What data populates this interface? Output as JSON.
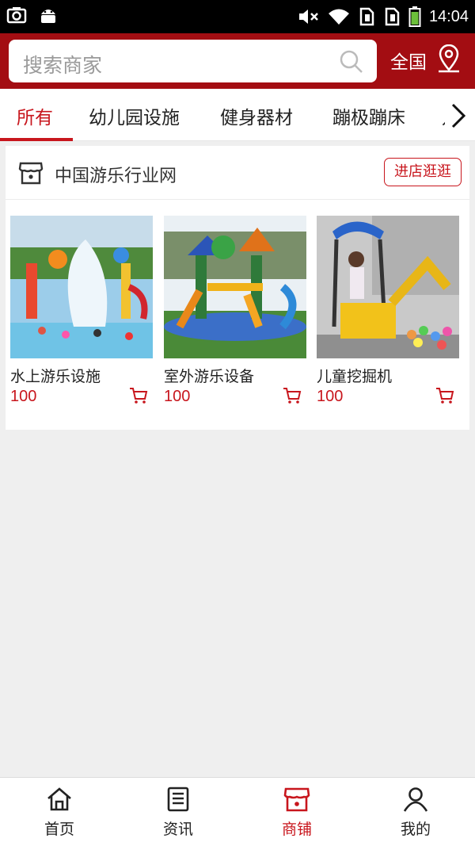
{
  "status_bar": {
    "time": "14:04",
    "left_icons": [
      "screenshot-icon",
      "android-icon"
    ],
    "right_icons": [
      "mute-icon",
      "wifi-icon",
      "sim1-icon",
      "sim2-icon",
      "battery-icon"
    ]
  },
  "header": {
    "search_placeholder": "搜索商家",
    "region_label": "全国",
    "bg_color": "#a30d12"
  },
  "tabs": {
    "items": [
      {
        "label": "所有",
        "active": true
      },
      {
        "label": "幼儿园设施",
        "active": false
      },
      {
        "label": "健身器材",
        "active": false
      },
      {
        "label": "蹦极蹦床",
        "active": false
      }
    ],
    "cut_label": "儿"
  },
  "store": {
    "name": "中国游乐行业网",
    "visit_label": "进店逛逛",
    "products": [
      {
        "title": "水上游乐设施",
        "price": "100"
      },
      {
        "title": "室外游乐设备",
        "price": "100"
      },
      {
        "title": "儿童挖掘机",
        "price": "100"
      }
    ]
  },
  "bottom_nav": {
    "items": [
      {
        "label": "首页",
        "icon": "home-icon",
        "active": false
      },
      {
        "label": "资讯",
        "icon": "news-icon",
        "active": false
      },
      {
        "label": "商铺",
        "icon": "shop-icon",
        "active": true
      },
      {
        "label": "我的",
        "icon": "profile-icon",
        "active": false
      }
    ]
  },
  "colors": {
    "accent": "#c8161d",
    "header": "#a30d12",
    "background": "#efefef"
  }
}
